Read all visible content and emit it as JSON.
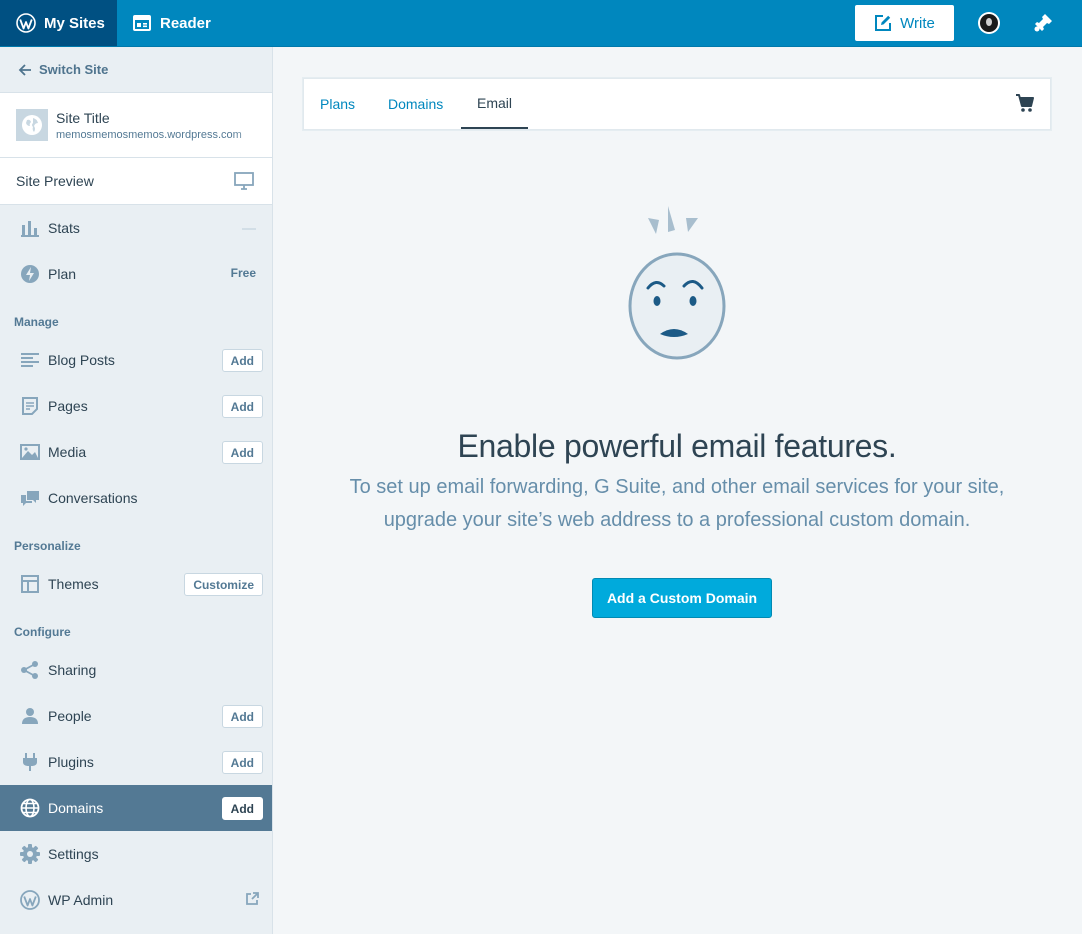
{
  "masterbar": {
    "my_sites": "My Sites",
    "reader": "Reader",
    "write": "Write"
  },
  "sidebar": {
    "switch_site": "Switch Site",
    "site": {
      "title": "Site Title",
      "url": "memosmemosmemos.wordpress.com"
    },
    "site_preview": "Site Preview",
    "stats": "Stats",
    "plan": {
      "label": "Plan",
      "badge": "Free"
    },
    "headings": {
      "manage": "Manage",
      "personalize": "Personalize",
      "configure": "Configure"
    },
    "manage": [
      {
        "label": "Blog Posts",
        "button": "Add"
      },
      {
        "label": "Pages",
        "button": "Add"
      },
      {
        "label": "Media",
        "button": "Add"
      },
      {
        "label": "Conversations"
      }
    ],
    "personalize": [
      {
        "label": "Themes",
        "button": "Customize"
      }
    ],
    "configure": [
      {
        "label": "Sharing"
      },
      {
        "label": "People",
        "button": "Add"
      },
      {
        "label": "Plugins",
        "button": "Add"
      },
      {
        "label": "Domains",
        "button": "Add",
        "selected": true
      },
      {
        "label": "Settings"
      },
      {
        "label": "WP Admin"
      }
    ]
  },
  "tabs": [
    {
      "label": "Plans"
    },
    {
      "label": "Domains"
    },
    {
      "label": "Email",
      "active": true
    }
  ],
  "empty_state": {
    "title": "Enable powerful email features.",
    "line1": "To set up email forwarding, G Suite, and other email services for your site,",
    "line2": "upgrade your site’s web address to a professional custom domain.",
    "cta": "Add a Custom Domain"
  },
  "colors": {
    "masterbar": "#0087be",
    "masterbar_active": "#005082",
    "sidebar_bg": "#e9eff3",
    "selected": "#537994",
    "cta": "#00aadc",
    "text": "#2e4453"
  },
  "icons": {
    "masterbar": [
      "wordpress-logo-icon",
      "reader-icon",
      "write-icon",
      "avatar",
      "notifications-icon"
    ],
    "sidebar": [
      "arrow-left-icon",
      "globe-icon",
      "monitor-icon",
      "stats-icon",
      "plan-icon",
      "posts-icon",
      "pages-icon",
      "media-icon",
      "conversations-icon",
      "themes-icon",
      "share-icon",
      "people-icon",
      "plugins-icon",
      "domains-globe-icon",
      "gear-icon",
      "wordpress-icon",
      "external-link-icon"
    ],
    "main": [
      "cart-icon",
      "confused-face-illustration"
    ]
  }
}
